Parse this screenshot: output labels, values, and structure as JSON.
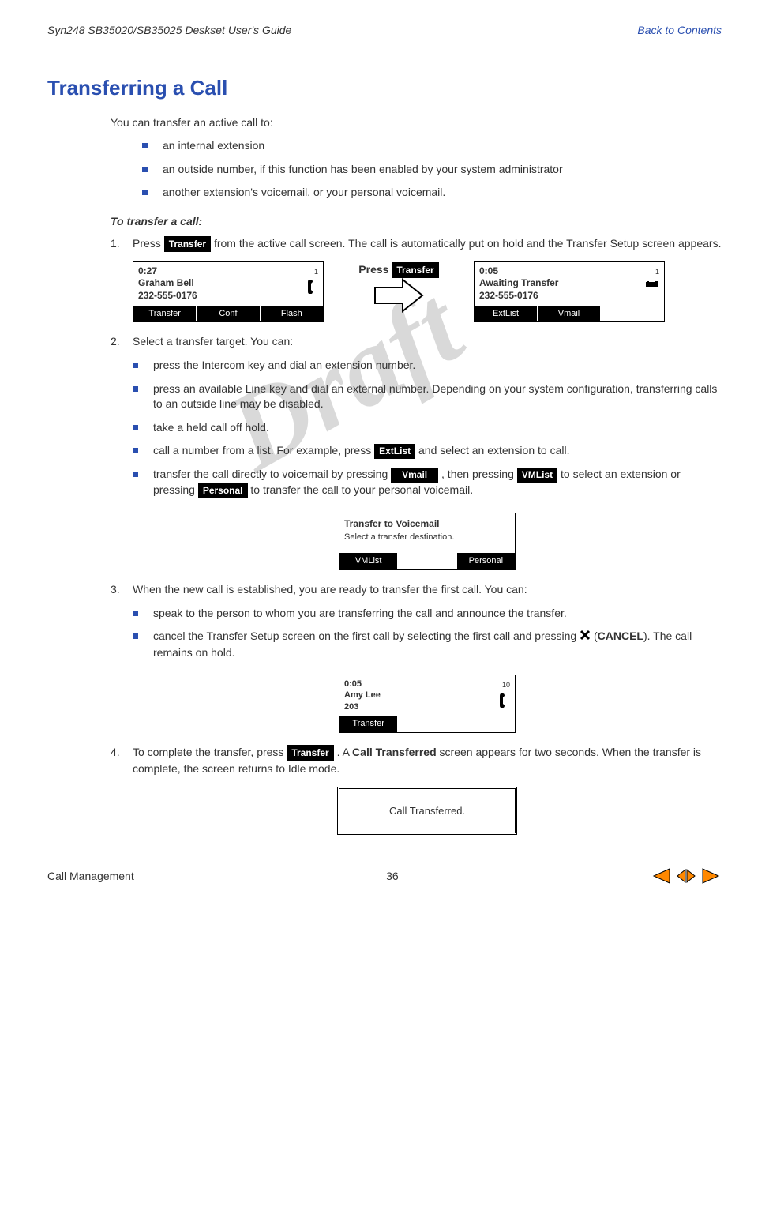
{
  "header": {
    "left": "Syn248 SB35020/SB35025 Deskset User's Guide",
    "right": "Back to Contents"
  },
  "title": "Transferring a Call",
  "intro": "You can transfer an active call to:",
  "intro_bullets": [
    "an internal extension",
    "an outside number, if this function has been enabled by your system administrator",
    "another extension's voicemail, or your personal voicemail."
  ],
  "subheading": "To transfer a call:",
  "step1": {
    "num": "1.",
    "pre": "Press ",
    "btn": "Transfer",
    "post": " from the active call screen. The call is automatically put on hold and the Transfer Setup screen appears."
  },
  "lcd1": {
    "time": "0:27",
    "line1": "Graham Bell",
    "line2": "232-555-0176",
    "indicator": "1",
    "sk1": "Transfer",
    "sk2": "Conf",
    "sk3": "Flash"
  },
  "arrow_label_pre": "Press ",
  "arrow_label_btn": "Transfer",
  "lcd2": {
    "time": "0:05",
    "line1": "Awaiting Transfer",
    "line2": "232-555-0176",
    "indicator": "1",
    "sk1": "ExtList",
    "sk2": "Vmail"
  },
  "step2": {
    "num": "2.",
    "text": "Select a transfer target. You can:"
  },
  "step2_bullets": {
    "b1": "press the Intercom key and dial an extension number.",
    "b2": "press an available Line key and dial an external number. Depending on your system configuration, transferring calls to an outside line may be disabled.",
    "b3": "take a held call off hold.",
    "b4_pre": "call a number from a list. For example, press ",
    "b4_btn": "ExtList",
    "b4_post": " and select an extension to call.",
    "b5_pre": "transfer the call directly to voicemail by pressing ",
    "b5_btn1": "Vmail",
    "b5_mid1": " , then pressing ",
    "b5_btn2": "VMList",
    "b5_mid2": " to select an extension or pressing ",
    "b5_btn3": "Personal",
    "b5_post": " to transfer the call to your personal voicemail."
  },
  "lcd_vmail": {
    "title": "Transfer to Voicemail",
    "subtitle": "Select a transfer destination.",
    "sk1": "VMList",
    "sk2": "Personal"
  },
  "step3": {
    "num": "3.",
    "text": "When the new call is established, you are ready to transfer the first call. You can:"
  },
  "step3_bullets": {
    "b1": "speak to the person to whom you are transferring the call and announce the transfer.",
    "b2_pre": "cancel the Transfer Setup screen on the first call by selecting the first call and pressing ",
    "b2_cancel_label": "CANCEL",
    "b2_post": "). The call remains on hold."
  },
  "lcd3": {
    "time": "0:05",
    "line1": "Amy Lee",
    "line2": "203",
    "indicator": "10",
    "sk1": "Transfer"
  },
  "step4": {
    "num": "4.",
    "pre": "To complete the transfer, press ",
    "btn": "Transfer",
    "mid": " . A ",
    "bold": "Call Transferred",
    "post": " screen appears for two seconds. When the transfer is complete, the screen returns to Idle mode."
  },
  "lcd_transferred": "Call Transferred.",
  "footer": {
    "left": "Call Management",
    "page": "36"
  },
  "watermark": "Draft"
}
